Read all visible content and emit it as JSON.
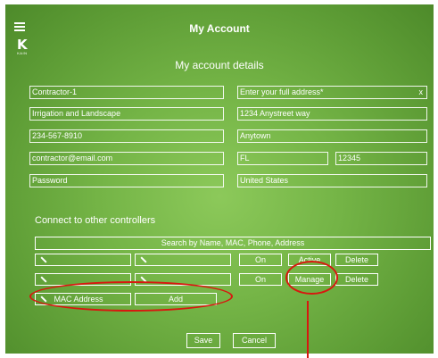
{
  "header": {
    "title": "My Account",
    "logo_letter": "K",
    "logo_sub": "KAIN"
  },
  "details": {
    "heading": "My account details",
    "company_name": "Contractor-1",
    "business_type": "Irrigation and Landscape",
    "phone": "234-567-8910",
    "email": "contractor@email.com",
    "password": "Password",
    "address_placeholder": "Enter your full address*",
    "address_clear": "x",
    "street": "1234 Anystreet way",
    "city": "Anytown",
    "state": "FL",
    "zip": "12345",
    "country": "United States"
  },
  "controllers": {
    "heading": "Connect to other controllers",
    "search_placeholder": "Search by Name, MAC, Phone, Address",
    "rows": [
      {
        "on_label": "On",
        "status_label": "Active",
        "delete_label": "Delete"
      },
      {
        "on_label": "On",
        "status_label": "Manage",
        "delete_label": "Delete"
      }
    ],
    "mac_placeholder": "MAC Address",
    "add_label": "Add"
  },
  "footer": {
    "save_label": "Save",
    "cancel_label": "Cancel"
  },
  "colors": {
    "annotation": "#d8170f",
    "background": "#74b446"
  }
}
